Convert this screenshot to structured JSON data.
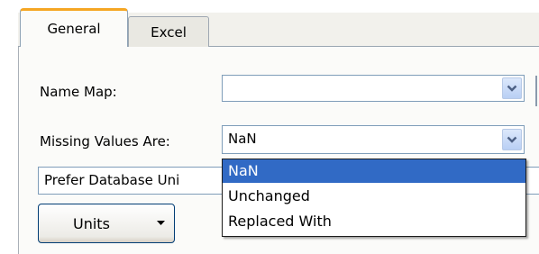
{
  "tabs": [
    {
      "label": "General",
      "active": true
    },
    {
      "label": "Excel",
      "active": false
    }
  ],
  "name_map": {
    "label": "Name Map:",
    "value": ""
  },
  "missing_values": {
    "label": "Missing Values Are:",
    "value": "NaN",
    "options": [
      "NaN",
      "Unchanged",
      "Replaced With"
    ],
    "highlighted": "NaN"
  },
  "prefer_units": {
    "value": "Prefer Database Uni"
  },
  "units_button": {
    "label": "Units"
  },
  "colors": {
    "tab_accent": "#f5a623",
    "selection": "#316ac5",
    "border": "#7f9db9"
  },
  "icons": {
    "combo_button": "chevron-down-icon",
    "units_caret": "caret-down-icon"
  }
}
